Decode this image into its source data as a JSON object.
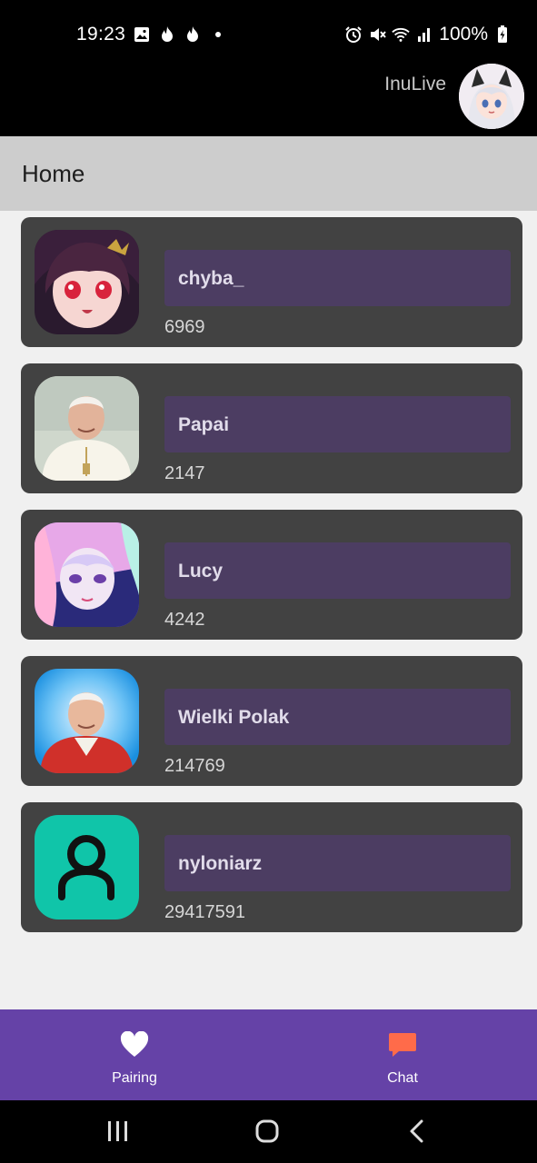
{
  "status_bar": {
    "time": "19:23",
    "battery": "100%",
    "left_icons": [
      "gallery-icon",
      "flame-icon",
      "flame-icon",
      "dot-icon"
    ],
    "right_icons": [
      "alarm-icon",
      "mute-icon",
      "wifi-icon",
      "signal-icon",
      "battery-charging-icon"
    ]
  },
  "header": {
    "app_name": "InuLive"
  },
  "toolbar": {
    "title": "Home"
  },
  "items": [
    {
      "name": "chyba_",
      "number": "6969"
    },
    {
      "name": "Papai",
      "number": "2147"
    },
    {
      "name": "Lucy",
      "number": "4242"
    },
    {
      "name": "Wielki Polak",
      "number": "214769"
    },
    {
      "name": "nyloniarz",
      "number": "29417591"
    }
  ],
  "bottom_nav": {
    "pairing_label": "Pairing",
    "chat_label": "Chat"
  },
  "colors": {
    "accent": "#6542a7",
    "card_bg": "#424242",
    "name_box": "#4c3d62",
    "chat_icon": "#ff6b4a"
  }
}
